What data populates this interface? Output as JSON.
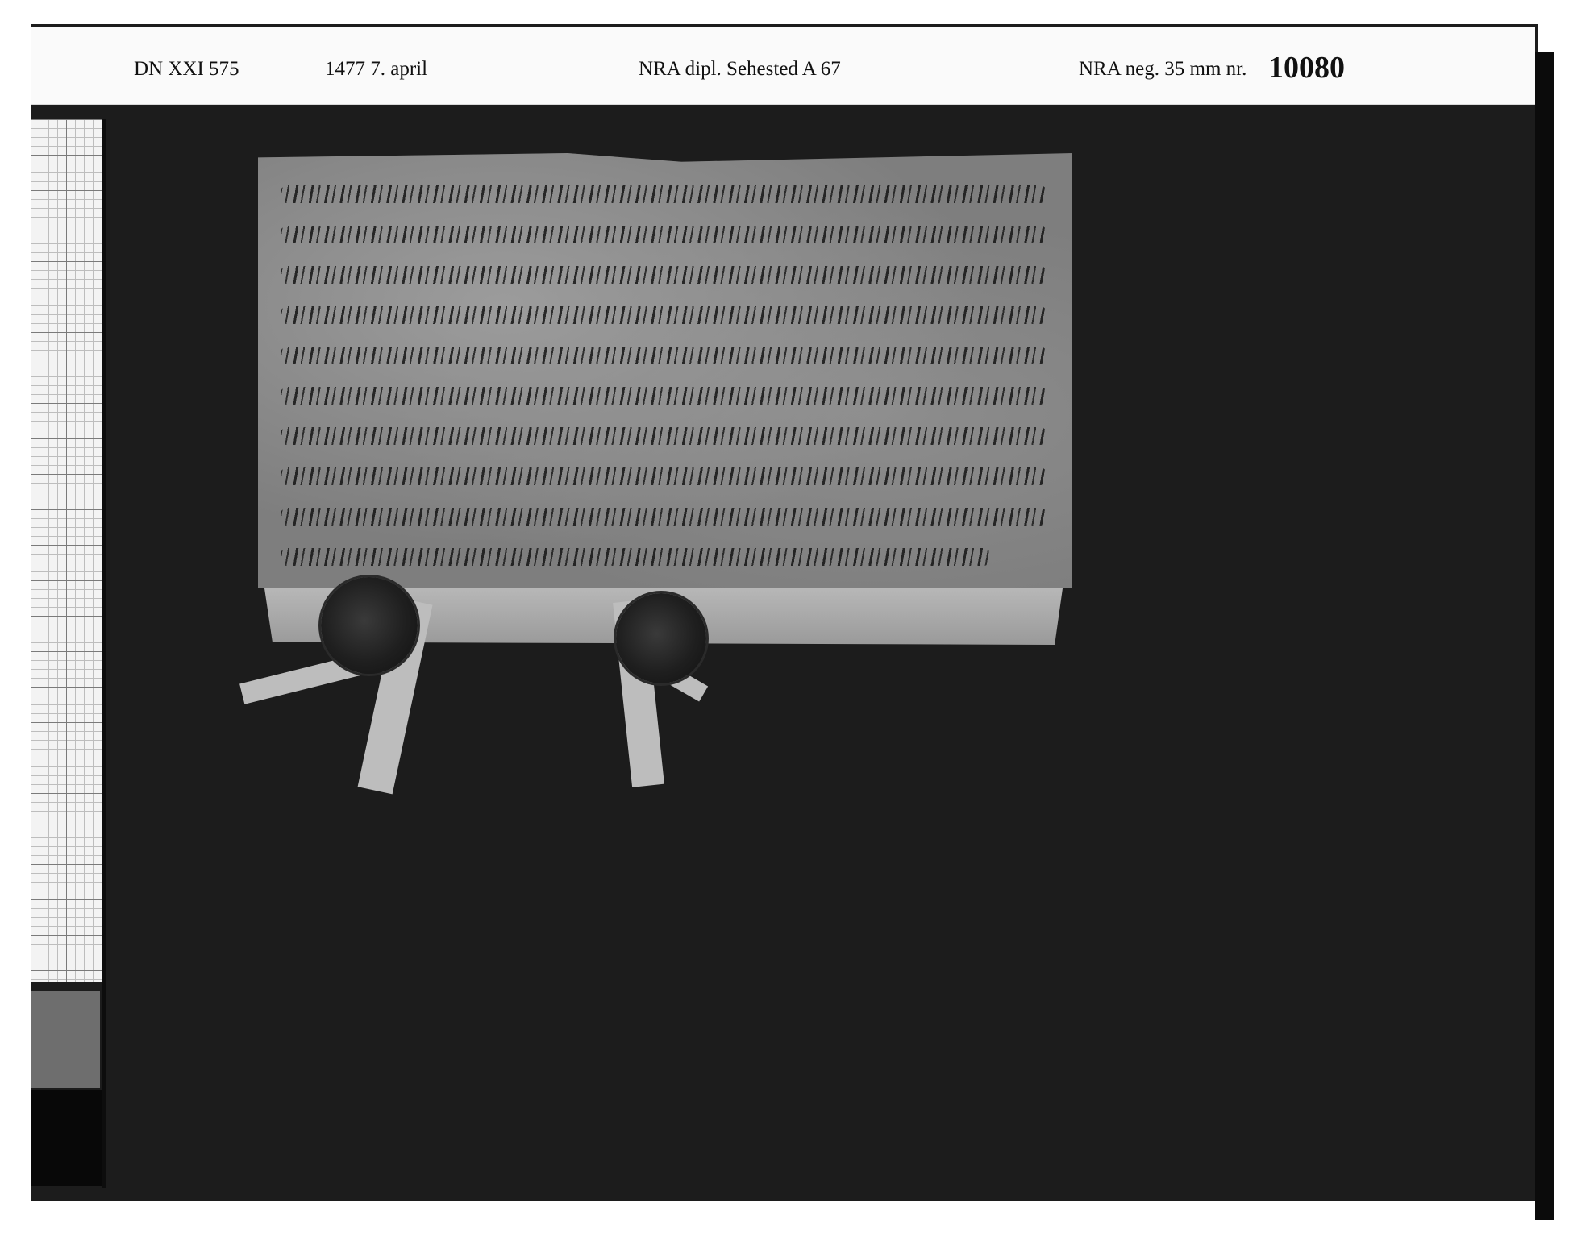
{
  "label_strip": {
    "reference": "DN XXI 575",
    "date": "1477  7. april",
    "archive": "NRA dipl.  Sehested A 67",
    "negative_prefix": "NRA neg. 35 mm nr.",
    "negative_number": "10080"
  },
  "document": {
    "kind": "medieval parchment charter with two hanging wax seals",
    "seal_count": 2
  },
  "colors": {
    "background": "#1c1c1c",
    "label_strip": "#fafafa",
    "parchment": "#8a8a8a",
    "scale_gray": "#6e6e6e",
    "scale_black": "#080808"
  }
}
